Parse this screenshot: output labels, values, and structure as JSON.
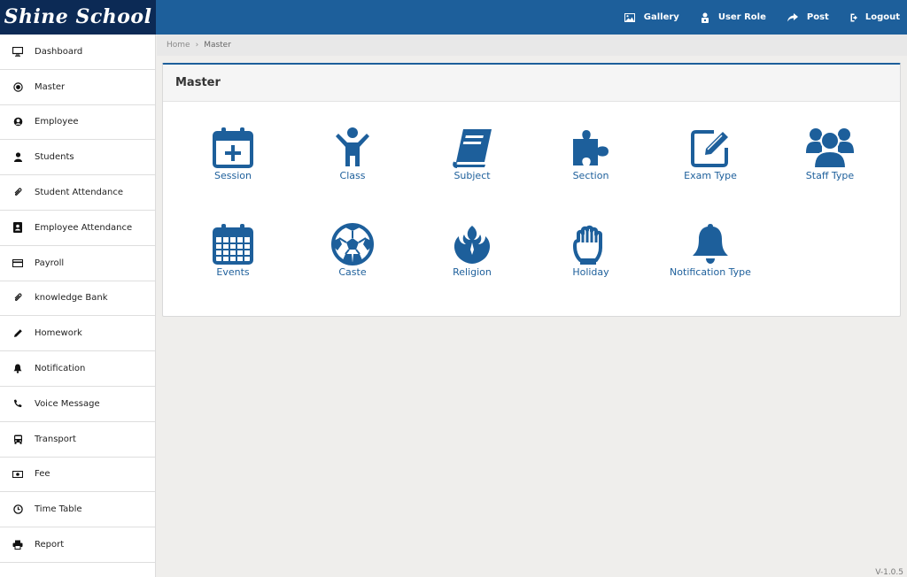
{
  "brand": "Shine School",
  "topnav": [
    {
      "label": "Gallery",
      "icon": "image-icon"
    },
    {
      "label": "User Role",
      "icon": "user-lock-icon"
    },
    {
      "label": "Post",
      "icon": "share-arrow-icon"
    },
    {
      "label": "Logout",
      "icon": "logout-icon"
    }
  ],
  "sidebar": {
    "items": [
      {
        "label": "Dashboard",
        "icon": "monitor-icon"
      },
      {
        "label": "Master",
        "icon": "record-icon"
      },
      {
        "label": "Employee",
        "icon": "user-circle-icon"
      },
      {
        "label": "Students",
        "icon": "user-icon"
      },
      {
        "label": "Student Attendance",
        "icon": "paperclip-icon"
      },
      {
        "label": "Employee Attendance",
        "icon": "id-badge-icon"
      },
      {
        "label": "Payroll",
        "icon": "credit-card-icon"
      },
      {
        "label": "knowledge Bank",
        "icon": "paperclip-icon"
      },
      {
        "label": "Homework",
        "icon": "pencil-icon"
      },
      {
        "label": "Notification",
        "icon": "bell-icon"
      },
      {
        "label": "Voice Message",
        "icon": "phone-icon"
      },
      {
        "label": "Transport",
        "icon": "bus-icon"
      },
      {
        "label": "Fee",
        "icon": "money-icon"
      },
      {
        "label": "Time Table",
        "icon": "clock-icon"
      },
      {
        "label": "Report",
        "icon": "printer-icon"
      }
    ]
  },
  "breadcrumb": {
    "home": "Home",
    "current": "Master"
  },
  "panel": {
    "title": "Master",
    "tiles": [
      {
        "label": "Session",
        "icon": "calendar-plus-icon"
      },
      {
        "label": "Class",
        "icon": "child-icon"
      },
      {
        "label": "Subject",
        "icon": "book-icon"
      },
      {
        "label": "Section",
        "icon": "puzzle-icon"
      },
      {
        "label": "Exam Type",
        "icon": "edit-icon"
      },
      {
        "label": "Staff Type",
        "icon": "users-icon"
      },
      {
        "label": "Events",
        "icon": "calendar-grid-icon"
      },
      {
        "label": "Caste",
        "icon": "soccer-ball-icon"
      },
      {
        "label": "Religion",
        "icon": "rebel-icon"
      },
      {
        "label": "Holiday",
        "icon": "hand-icon"
      },
      {
        "label": "Notification Type",
        "icon": "bell-icon"
      }
    ]
  },
  "version": "V-1.0.5",
  "colors": {
    "primary": "#1d5f9b",
    "brand_bg": "#0c2a55",
    "accent_blue": "#1d5f9b"
  }
}
